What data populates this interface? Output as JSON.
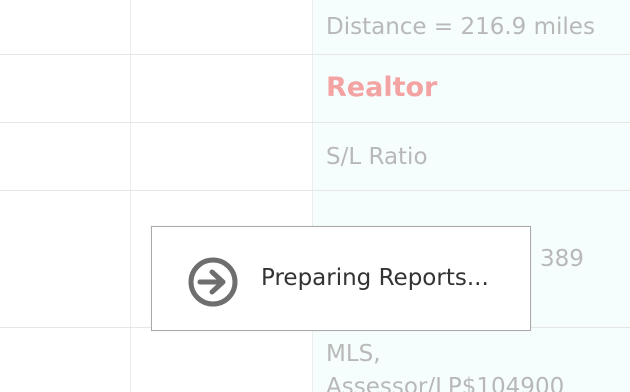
{
  "grid": {
    "rows": [
      {
        "text": "Distance = 216.9 miles"
      },
      {
        "text": "Realtor"
      },
      {
        "text": "S/L Ratio"
      },
      {
        "text": "389"
      },
      {
        "text": "MLS,"
      },
      {
        "text": "Assessor/LP$104900"
      }
    ]
  },
  "dialog": {
    "icon": "arrow-right-circle-icon",
    "message": "Preparing Reports..."
  },
  "colors": {
    "title_accent": "#f4a3a3",
    "faded_text": "#b8b8b8",
    "column_tint": "#f6fdfd",
    "icon_gray": "#6e6e6e"
  }
}
